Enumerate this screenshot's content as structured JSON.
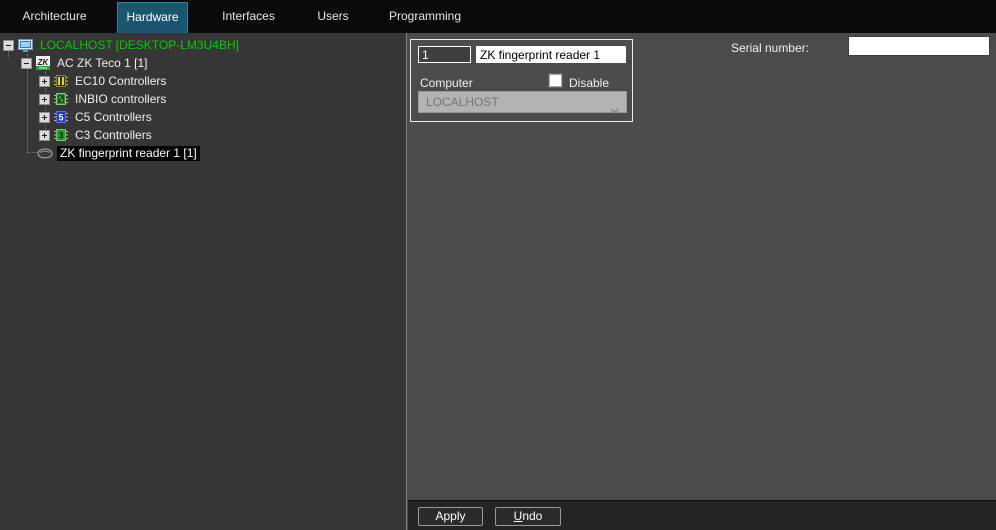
{
  "colors": {
    "active_tab_bg": "#19566f",
    "active_tab_border": "#2f81a8",
    "tree_root_text_green": "#00d000",
    "selection_bg": "#000000",
    "selection_text": "#ffffff",
    "left_panel_bg": "#363636",
    "right_panel_bg": "#4b4b4b",
    "navbar_bg": "#0a0a0a"
  },
  "nav": {
    "active_tab": "Hardware",
    "tabs": [
      {
        "label": "Architecture"
      },
      {
        "label": "Hardware"
      },
      {
        "label": "Interfaces"
      },
      {
        "label": "Users"
      },
      {
        "label": "Programming"
      }
    ]
  },
  "tree": {
    "items": [
      {
        "label": "LOCALHOST [DESKTOP-LM3U4BH]",
        "icon": "computer-icon",
        "level": 0,
        "expander": "minus",
        "selected": false
      },
      {
        "label": "AC ZK Teco 1 [1]",
        "icon": "zk-teco-logo-icon",
        "level": 1,
        "expander": "minus",
        "selected": false
      },
      {
        "label": "EC10 Controllers",
        "icon": "ec10-chip-icon",
        "level": 2,
        "expander": "plus",
        "selected": false
      },
      {
        "label": "INBIO controllers",
        "icon": "inbio-chip-icon",
        "level": 2,
        "expander": "plus",
        "selected": false
      },
      {
        "label": "C5 Controllers",
        "icon": "c5-chip-icon",
        "level": 2,
        "expander": "plus",
        "selected": false
      },
      {
        "label": "C3 Controllers",
        "icon": "c3-chip-icon",
        "level": 2,
        "expander": "plus",
        "selected": false
      },
      {
        "label": "ZK fingerprint reader 1 [1]",
        "icon": "fingerprint-reader-icon",
        "level": 1,
        "expander": "none",
        "selected": true
      }
    ]
  },
  "form": {
    "device_number_value": "1",
    "device_name_value": "ZK fingerprint reader 1",
    "computer_label": "Computer",
    "disable_label": "Disable",
    "disable_checked": false,
    "computer_select_value": "LOCALHOST",
    "serial_number_label": "Serial number:",
    "serial_number_value": ""
  },
  "footer": {
    "apply_label": "Apply",
    "undo_accel": "U",
    "undo_rest": "ndo"
  }
}
